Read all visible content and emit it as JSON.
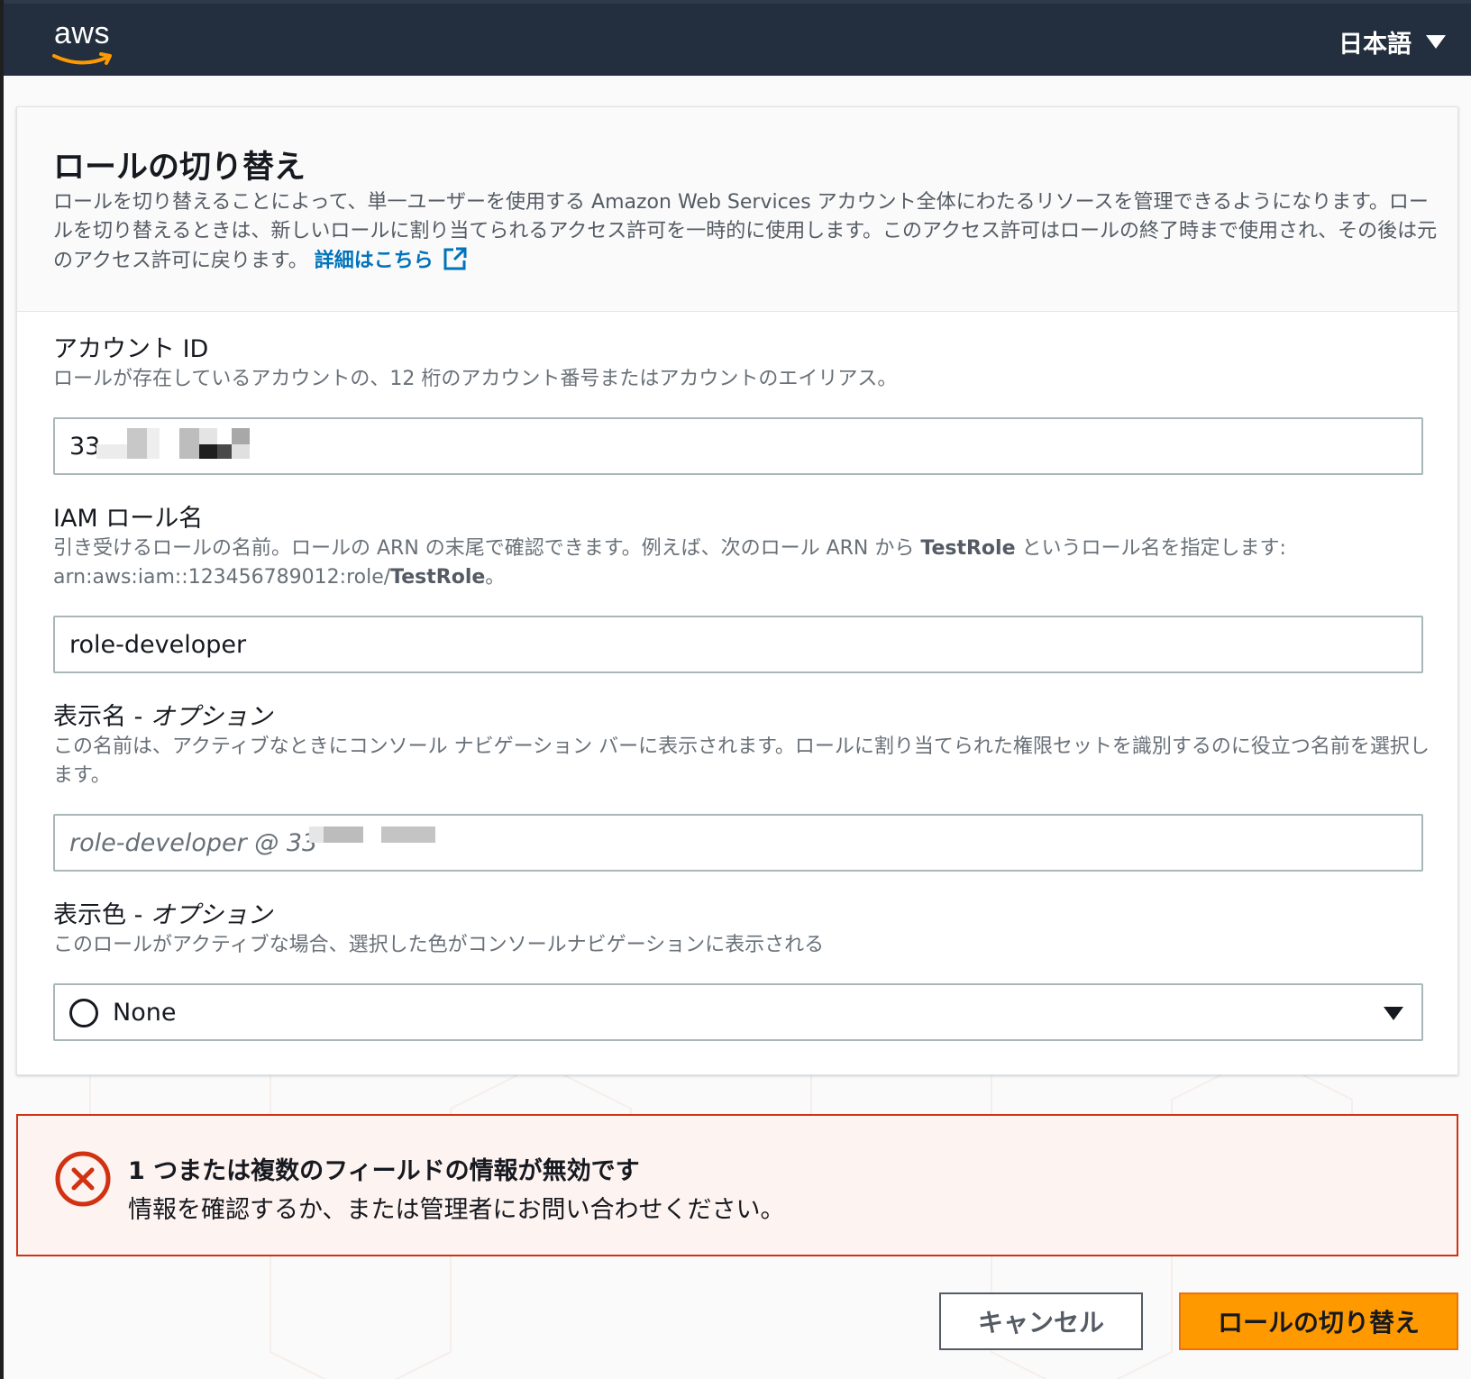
{
  "header": {
    "logo_text": "aws",
    "language": "日本語"
  },
  "card": {
    "title": "ロールの切り替え",
    "description": "ロールを切り替えることによって、単一ユーザーを使用する Amazon Web Services アカウント全体にわたるリソースを管理できるようになります。ロールを切り替えるときは、新しいロールに割り当てられるアクセス許可を一時的に使用します。このアクセス許可はロールの終了時まで使用され、その後は元のアクセス許可に戻ります。",
    "learn_more": "詳細はこちら"
  },
  "fields": {
    "account": {
      "label": "アカウント ID",
      "hint": "ロールが存在しているアカウントの、12 桁のアカウント番号またはアカウントのエイリアス。",
      "value_visible": "33"
    },
    "role": {
      "label": "IAM ロール名",
      "hint_1": "引き受けるロールの名前。ロールの ARN の末尾で確認できます。例えば、次のロール ARN から ",
      "hint_bold": "TestRole",
      "hint_2": " というロール名を指定します:",
      "hint_arn_prefix": "arn:aws:iam::123456789012:role/",
      "hint_arn_bold": "TestRole",
      "hint_arn_suffix": "。",
      "value": "role-developer"
    },
    "display_name": {
      "label_main": "表示名 - ",
      "label_optional": "オプション",
      "hint": "この名前は、アクティブなときにコンソール ナビゲーション バーに表示されます。ロールに割り当てられた権限セットを識別するのに役立つ名前を選択します。",
      "placeholder_visible": "role-developer @ 33"
    },
    "color": {
      "label_main": "表示色 - ",
      "label_optional": "オプション",
      "hint": "このロールがアクティブな場合、選択した色がコンソールナビゲーションに表示される",
      "value": "None"
    }
  },
  "alert": {
    "title": "1 つまたは複数のフィールドの情報が無効です",
    "body": "情報を確認するか、または管理者にお問い合わせください。"
  },
  "buttons": {
    "cancel": "キャンセル",
    "submit": "ロールの切り替え"
  },
  "colors": {
    "header_bg": "#232f3e",
    "link": "#0073bb",
    "primary": "#ff9900",
    "error": "#d13212"
  }
}
